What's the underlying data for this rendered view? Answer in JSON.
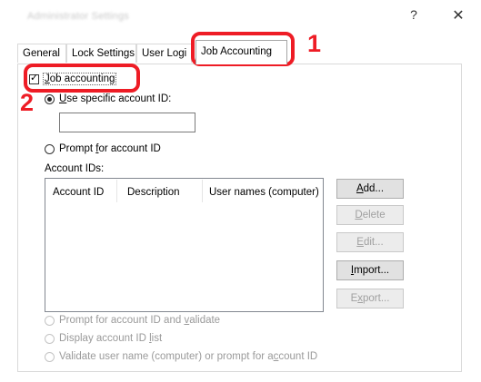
{
  "window": {
    "title": "Administrator Settings",
    "help_label": "?",
    "close_label": "✕"
  },
  "tabs": [
    {
      "label": "General"
    },
    {
      "label": "Lock Settings"
    },
    {
      "label": "User Logi"
    },
    {
      "label": "Job Accounting"
    }
  ],
  "callouts": {
    "one": "1",
    "two": "2"
  },
  "job_accounting": {
    "pre": "",
    "u": "J",
    "post": "ob accounting",
    "checked": true
  },
  "use_specific": {
    "pre": "",
    "u": "U",
    "post": "se specific account ID:",
    "selected": true
  },
  "account_id_value": "",
  "prompt_for_id": {
    "pre": "Prompt ",
    "u": "f",
    "post": "or account ID"
  },
  "account_ids_label": "Account IDs:",
  "columns": [
    "Account ID",
    "Description",
    "User names (computer)"
  ],
  "buttons": {
    "add": {
      "pre": "",
      "u": "A",
      "post": "dd..."
    },
    "delete": {
      "pre": "",
      "u": "D",
      "post": "elete"
    },
    "edit": {
      "pre": "",
      "u": "E",
      "post": "dit..."
    },
    "import": {
      "pre": "",
      "u": "I",
      "post": "mport..."
    },
    "export": {
      "pre": "E",
      "u": "x",
      "post": "port..."
    }
  },
  "options": {
    "validate": {
      "pre": "Prompt for account ID and ",
      "u": "v",
      "post": "alidate"
    },
    "display_list": {
      "pre": "Display account ID ",
      "u": "l",
      "post": "ist"
    },
    "validate_user": {
      "pre": "Validate user name (computer) or prompt for a",
      "u": "c",
      "post": "count ID"
    }
  }
}
